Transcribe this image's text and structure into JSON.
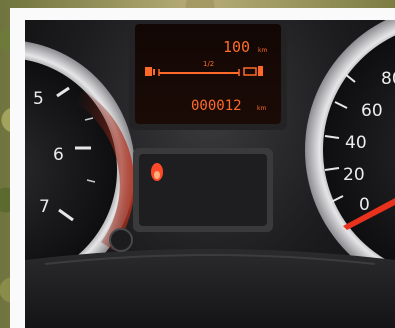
{
  "display": {
    "speed_value": "100",
    "speed_unit": "km",
    "fuel_scale_mid": "1/2",
    "odometer_value": "000012",
    "odometer_unit": "km"
  },
  "tachometer": {
    "labels": [
      "5",
      "6",
      "7"
    ]
  },
  "speedometer": {
    "labels": [
      "80",
      "60",
      "40",
      "20",
      "0"
    ]
  },
  "colors": {
    "lcd_orange": "#ff6a2a",
    "needle_red": "#e8321e",
    "warning_red": "#ff4a2a",
    "dash_dark": "#1a1a1c"
  },
  "icons": {
    "fuel_pump": "fuel-pump-icon",
    "service_wrench": "wrench-icon",
    "warning_light": "warning-light-icon"
  }
}
